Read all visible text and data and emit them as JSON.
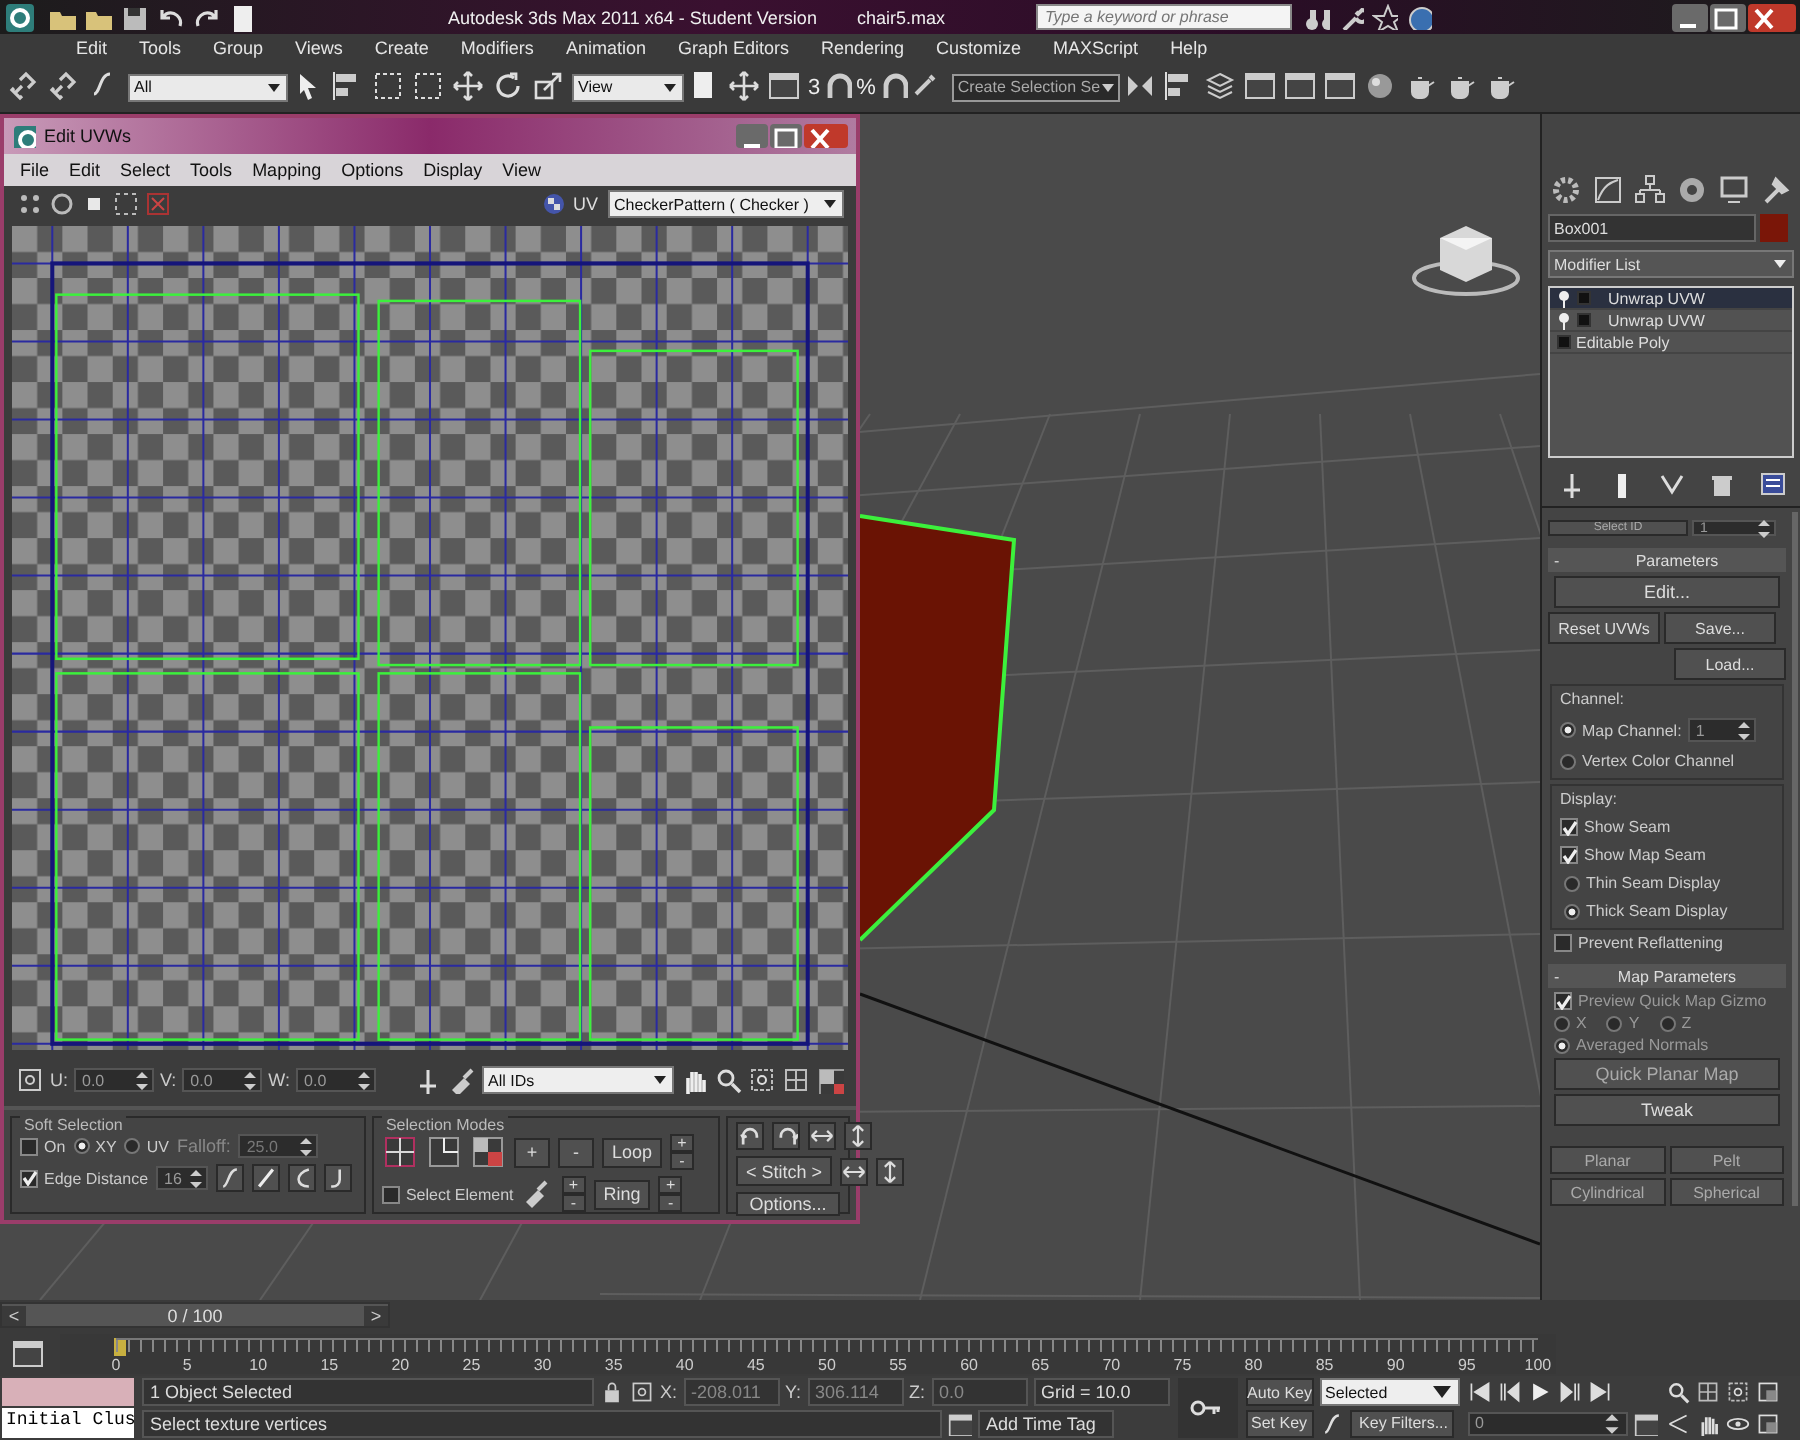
{
  "app": {
    "title": "Autodesk 3ds Max  2011 x64  - Student Version",
    "file": "chair5.max",
    "search": {
      "placeholder": "Type a keyword or phrase"
    }
  },
  "menu": [
    "Edit",
    "Tools",
    "Group",
    "Views",
    "Create",
    "Modifiers",
    "Animation",
    "Graph Editors",
    "Rendering",
    "Customize",
    "MAXScript",
    "Help"
  ],
  "toolbar": {
    "selection_filter": "All",
    "reference_coord": "View",
    "snap_labels": [
      "3",
      "%"
    ],
    "named_selection": "Create Selection Se"
  },
  "uvw_editor": {
    "title": "Edit UVWs",
    "menu": [
      "File",
      "Edit",
      "Select",
      "Tools",
      "Mapping",
      "Options",
      "Display",
      "View"
    ],
    "uv_label": "UV",
    "texture": "CheckerPattern  ( Checker )",
    "coords": [
      {
        "label": "U:",
        "value": "0.0"
      },
      {
        "label": "V:",
        "value": "0.0"
      },
      {
        "label": "W:",
        "value": "0.0"
      }
    ],
    "id_filter": "All IDs",
    "soft_selection": {
      "title": "Soft Selection",
      "on": {
        "label": "On",
        "checked": false
      },
      "modes": [
        {
          "label": "XY",
          "selected": true
        },
        {
          "label": "UV",
          "selected": false
        }
      ],
      "falloff_label": "Falloff:",
      "falloff": "25.0",
      "edge_distance": {
        "label": "Edge Distance",
        "checked": true
      },
      "edge_distance_value": "16"
    },
    "selection_modes": {
      "title": "Selection Modes",
      "grow": "+",
      "shrink": "-",
      "loop": "Loop",
      "ring": "Ring",
      "select_element": {
        "label": "Select Element",
        "checked": false
      },
      "spinner_signs": [
        "+",
        "-"
      ]
    },
    "stitch": "< Stitch >",
    "options": "Options..."
  },
  "command_panel": {
    "object_name": "Box001",
    "color": "#7a1608",
    "modifier_list": "Modifier List",
    "stack": [
      {
        "label": "Unwrap UVW",
        "kind": "modifier",
        "selected": true
      },
      {
        "label": "Unwrap UVW",
        "kind": "modifier",
        "selected": false
      },
      {
        "label": "Editable Poly",
        "kind": "base",
        "selected": false
      }
    ],
    "select_id": "Select ID",
    "select_id_value": "1",
    "parameters": {
      "title": "Parameters",
      "collapse": "-",
      "edit": "Edit...",
      "reset": "Reset UVWs",
      "save": "Save...",
      "load": "Load...",
      "channel_title": "Channel:",
      "channels": [
        {
          "label": "Map Channel:",
          "selected": true
        },
        {
          "label": "Vertex Color Channel",
          "selected": false
        }
      ],
      "map_channel_value": "1",
      "display_title": "Display:",
      "seams": [
        {
          "label": "Show Seam",
          "checked": true
        },
        {
          "label": "Show Map Seam",
          "checked": true
        }
      ],
      "seam_styles": [
        {
          "label": "Thin Seam Display",
          "selected": false
        },
        {
          "label": "Thick Seam Display",
          "selected": true
        }
      ],
      "prevent": {
        "label": "Prevent Reflattening",
        "checked": false
      }
    },
    "map_parameters": {
      "title": "Map Parameters",
      "collapse": "-",
      "preview": {
        "label": "Preview Quick Map Gizmo",
        "checked": true
      },
      "axes": [
        {
          "label": "X",
          "selected": false
        },
        {
          "label": "Y",
          "selected": false
        },
        {
          "label": "Z",
          "selected": false
        },
        {
          "label": "Averaged Normals",
          "selected": true
        }
      ],
      "quick_planar": "Quick Planar Map",
      "tweak": "Tweak",
      "buttons": [
        "Planar",
        "Pelt",
        "Cylindrical",
        "Spherical"
      ]
    }
  },
  "timeline": {
    "level": 0,
    "prev": "<",
    "position": "0 / 100",
    "next": ">",
    "ticks": [
      "0",
      "5",
      "10",
      "15",
      "20",
      "25",
      "30",
      "35",
      "40",
      "45",
      "50",
      "55",
      "60",
      "65",
      "70",
      "75",
      "80",
      "85",
      "90",
      "95",
      "100"
    ]
  },
  "status_bar": {
    "script_field": "Initial Clus",
    "selection": "1 Object Selected",
    "prompt": "Select texture vertices",
    "coords": [
      {
        "label": "X:",
        "value": "-208.011"
      },
      {
        "label": "Y:",
        "value": "306.114"
      },
      {
        "label": "Z:",
        "value": "0.0"
      }
    ],
    "grid": "Grid = 10.0",
    "time_tag": "Add Time Tag",
    "auto_key": "Auto Key",
    "key_mode": "Selected",
    "set_key": "Set Key",
    "key_filters": "Key Filters...",
    "frame": "0"
  }
}
